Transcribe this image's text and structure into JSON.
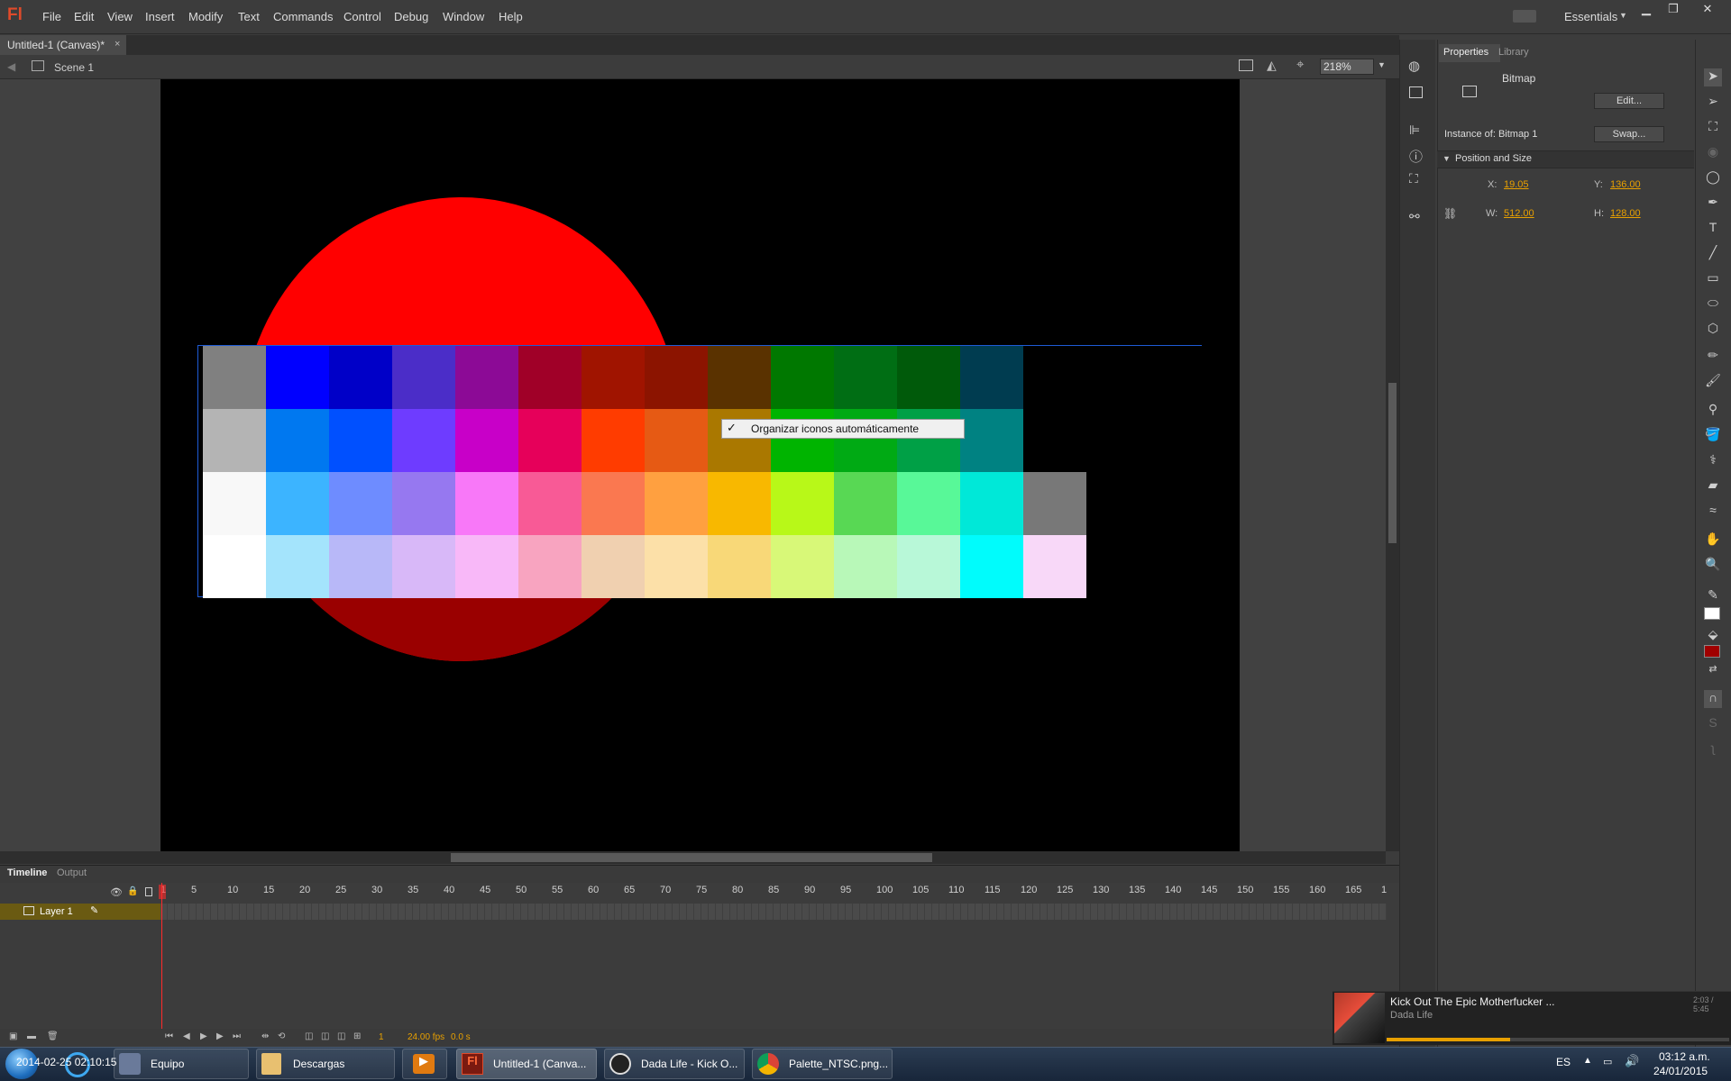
{
  "app": {
    "logo": "Fl",
    "workspace": "Essentials"
  },
  "menu": [
    "File",
    "Edit",
    "View",
    "Insert",
    "Modify",
    "Text",
    "Commands",
    "Control",
    "Debug",
    "Window",
    "Help"
  ],
  "document": {
    "tab_title": "Untitled-1 (Canvas)*",
    "close": "×"
  },
  "editbar": {
    "scene": "Scene 1",
    "zoom": "218%"
  },
  "context_menu": {
    "check": "✓",
    "label": "Organizar iconos automáticamente"
  },
  "palette": {
    "rows": [
      [
        "#808080",
        "#0000ff",
        "#0000c8",
        "#4b2dc8",
        "#8c0a96",
        "#a00028",
        "#a01400",
        "#8c1400",
        "#5a3200",
        "#007800",
        "#006e14",
        "#005a0a",
        "#003c50",
        "#000000",
        "#000000",
        "#000000"
      ],
      [
        "#b4b4b4",
        "#0078f0",
        "#0050ff",
        "#6e3cff",
        "#c800c8",
        "#e6005a",
        "#ff3c00",
        "#e65a14",
        "#aa7800",
        "#00b400",
        "#00aa14",
        "#00a046",
        "#008282",
        "#000000",
        "#000000",
        "#000000"
      ],
      [
        "#f8f8f8",
        "#3cb4ff",
        "#6e8cff",
        "#9678f0",
        "#f878f8",
        "#f85a96",
        "#fa7850",
        "#ffa040",
        "#f8b800",
        "#b8f818",
        "#58d854",
        "#58f898",
        "#00e8d8",
        "#787878",
        "#000000",
        "#000000"
      ],
      [
        "#ffffff",
        "#a4e4fc",
        "#b8b8f8",
        "#d8b8f8",
        "#f8b8f8",
        "#f8a4c0",
        "#f0d0b0",
        "#fce0a8",
        "#f8d878",
        "#d8f878",
        "#b8f8b8",
        "#b8f8d8",
        "#00fcfc",
        "#f8d8f8",
        "#000000",
        "#000000"
      ]
    ]
  },
  "timeline": {
    "tabs": [
      "Timeline",
      "Output"
    ],
    "ruler": [
      "1",
      "5",
      "10",
      "15",
      "20",
      "25",
      "30",
      "35",
      "40",
      "45",
      "50",
      "55",
      "60",
      "65",
      "70",
      "75",
      "80",
      "85",
      "90",
      "95",
      "100",
      "105",
      "110",
      "115",
      "120",
      "125",
      "130",
      "135",
      "140",
      "145",
      "150",
      "155",
      "160",
      "165",
      "1"
    ],
    "layer": "Layer 1",
    "current_frame": "1",
    "fps": "24.00 fps",
    "time": "0.0 s"
  },
  "properties": {
    "tabs": [
      "Properties",
      "Library"
    ],
    "type": "Bitmap",
    "edit": "Edit...",
    "instance_label": "Instance of:",
    "instance_value": "Bitmap 1",
    "swap": "Swap...",
    "section": "Position and Size",
    "x_label": "X:",
    "x": "19.05",
    "y_label": "Y:",
    "y": "136.00",
    "w_label": "W:",
    "w": "512.00",
    "h_label": "H:",
    "h": "128.00"
  },
  "media": {
    "title": "Kick Out The Epic Motherfucker ...",
    "artist": "Dada Life",
    "time": "2:03 / 5:45",
    "progress": 0.36
  },
  "taskbar": {
    "items": [
      "Equipo",
      "Descargas",
      "",
      "Untitled-1 (Canva...",
      "Dada Life - Kick O...",
      "Palette_NTSC.png..."
    ],
    "overlay": "2014-02-25 02:10:15",
    "lang": "ES",
    "time": "03:12 a.m.",
    "date": "24/01/2015"
  }
}
